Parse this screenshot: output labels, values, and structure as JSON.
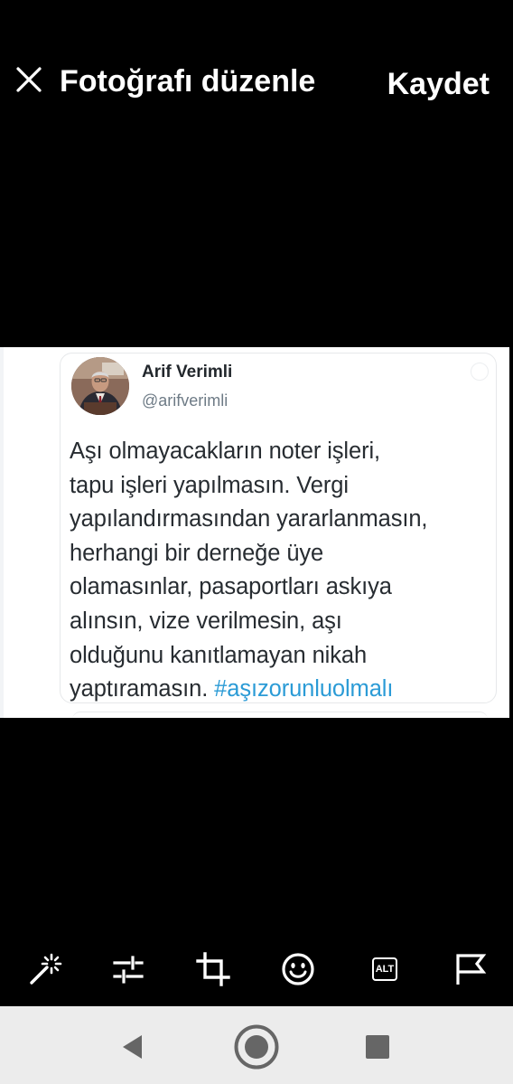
{
  "header": {
    "title": "Fotoğrafı düzenle",
    "save_label": "Kaydet"
  },
  "tweet": {
    "author_name": "Arif Verimli",
    "author_handle": "@arifverimli",
    "lines": [
      "Aşı olmayacakların noter işleri,",
      "tapu işleri yapılmasın. Vergi",
      "yapılandırmasından yararlanmasın,",
      "herhangi bir derneğe üye",
      "olamasınlar, pasaportları askıya",
      "alınsın, vize verilmesin, aşı",
      "olduğunu kanıtlamayan nikah",
      "yaptıramasın. "
    ],
    "hashtag": "#aşızorunluolmalı",
    "hashtag_color": "#2b9bd6"
  },
  "toolbar": {
    "alt_label": "ALT",
    "icons": [
      "magic-wand-icon",
      "adjust-sliders-icon",
      "crop-icon",
      "sticker-smiley-icon",
      "alt-text-icon",
      "flag-icon"
    ]
  },
  "navbar": {
    "icons": [
      "back-triangle-icon",
      "home-circle-icon",
      "recents-square-icon"
    ]
  },
  "colors": {
    "background": "#000000",
    "navbar": "#ececec",
    "nav_icons": "#666666"
  }
}
